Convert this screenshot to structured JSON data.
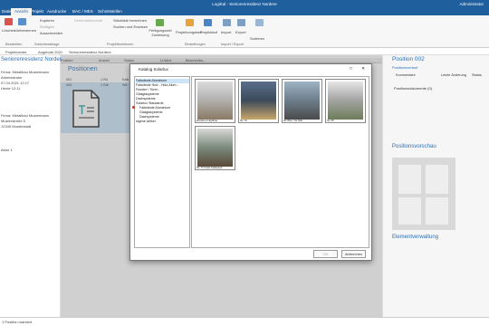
{
  "window": {
    "title": "LogiKal - Seniorenresidenz Nordere",
    "right": "Administrator"
  },
  "menu": [
    "Datei",
    "Ansicht",
    "Projekt",
    "Ausdrucke",
    "BAC / MES",
    "Schnittstellen"
  ],
  "ribbon": {
    "delete": "Löschen",
    "rename": "Umbenennen",
    "copy": "Kopieren",
    "paste": "Einfügen",
    "cut": "Ausschneiden",
    "clipboard_group": "Zwischenablage",
    "edit_group": "Bearbeiten",
    "calc_parts": "Stückliste berechnen",
    "search_replace": "Suchen und Ersetzen",
    "series_doc": "Seriendokumente",
    "prod_times": "Fertigungszeit Zuweisung",
    "proj_functions": "Projektfunktionen",
    "proj_settings": "Projektvorgaben",
    "proj_course": "Projektlauf",
    "settings_group": "Einstellungen",
    "import": "Import",
    "export": "Export",
    "import_export_group": "Import / Export",
    "sort": "Sortieren"
  },
  "breadcrumb": [
    "Projektcenter",
    "Angebote 2021",
    "Seniorenresidenz Nordere"
  ],
  "left": {
    "title": "Seniorenresidenz Nordere",
    "company": "Firma: Metallbau Mustermann",
    "user": "Administrator",
    "date1": "07.04.2021 12:17",
    "date_label": "Datum",
    "date2": "Heute 12:11",
    "address": [
      "Firma: Metallbau Mustermann",
      "Musterstraße 5",
      "12345 Musterstadt"
    ],
    "misc": "Aktor 1"
  },
  "center": {
    "title": "Positionen",
    "columns": [
      "Position",
      "Anzahl",
      "Status",
      "Kalkulation",
      "Endergebnis",
      "U-Wert",
      "Beschreibu..."
    ],
    "rows": [
      {
        "pos": "001",
        "qty": "1 Rü",
        "st": "Kalk"
      },
      {
        "pos": "002",
        "qty": "1 Stk",
        "st": "Wir"
      }
    ]
  },
  "right": {
    "title": "Position 002",
    "tab": "Positionsverlauf",
    "comments": "Kommentare",
    "last_change": "Letzte Änderung",
    "state": "Status",
    "docs": "Positionsdokumente (0)",
    "preview": "Positionsvorschau",
    "elements": "Elementverwaltung"
  },
  "dialog": {
    "title": "Katalog Solarlux",
    "ok": "OK",
    "cancel": "Abbrechen",
    "tree": [
      "Faltwände Aluminium",
      "Faltwände Holz - Holz-Alum...",
      "Fenster / Türen",
      "Glasglasysteme",
      "Dachsysteme",
      "Solarlux Standards",
      "Faltwände Aluminium",
      "Glasglasysteme",
      "Dachsysteme",
      "eigene Artikel"
    ],
    "tiles": [
      "Ecolineo Highline",
      "SL 70",
      "SL 80e / SL 82e",
      "SL 45",
      "SL 77 Dreh-Faltwand"
    ]
  },
  "status": "1 Position markiert"
}
